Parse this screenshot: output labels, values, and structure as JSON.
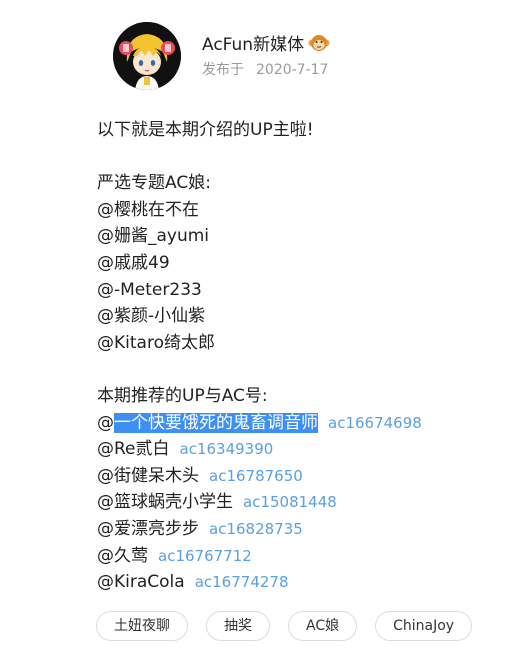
{
  "post": {
    "author": "AcFun新媒体",
    "author_badge": "monkey-badge-icon",
    "published_label": "发布于",
    "published_date": "2020-7-17"
  },
  "content": {
    "intro": "以下就是本期介绍的UP主啦!",
    "section1_title": "严选专题AC娘:",
    "section1_mentions": [
      "@樱桃在不在",
      "@姗酱_ayumi",
      "@戚戚49",
      "@-Meter233",
      "@紫颜-小仙紫",
      "@Kitaro绮太郎"
    ],
    "section2_title": "本期推荐的UP与AC号:",
    "section2_rows": [
      {
        "at": "@",
        "name": "一个快要饿死的鬼畜调音师",
        "ac": "ac16674698",
        "selected": true
      },
      {
        "at": "@",
        "name": "Re贰白",
        "ac": "ac16349390"
      },
      {
        "at": "@",
        "name": "街健呆木头",
        "ac": "ac16787650"
      },
      {
        "at": "@",
        "name": "篮球蜗壳小学生",
        "ac": "ac15081448"
      },
      {
        "at": "@",
        "name": "爱漂亮步步",
        "ac": "ac16828735"
      },
      {
        "at": "@",
        "name": "久莺",
        "ac": "ac16767712"
      },
      {
        "at": "@",
        "name": "KiraCola",
        "ac": "ac16774278"
      }
    ]
  },
  "tags": [
    "土妞夜聊",
    "抽奖",
    "AC娘",
    "ChinaJoy"
  ],
  "colors": {
    "link": "#5a9fe0",
    "selection": "#3d8ff0",
    "meta": "#9a9a9a"
  }
}
